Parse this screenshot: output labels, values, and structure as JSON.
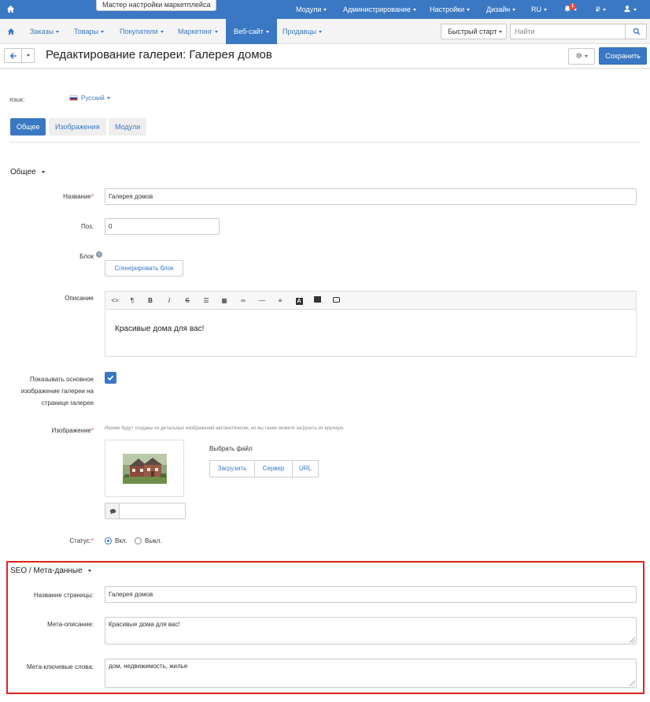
{
  "topbar": {
    "marketplace_btn": "Мастер настройки маркетплейса",
    "menus": [
      "Модули",
      "Администрирование",
      "Настройки",
      "Дизайн",
      "RU"
    ],
    "notif_count": "1",
    "currency": "₽"
  },
  "nav": {
    "items": [
      "Заказы",
      "Товары",
      "Покупатели",
      "Маркетинг",
      "Веб-сайт",
      "Продавцы"
    ],
    "quick_start": "Быстрый старт",
    "search_placeholder": "Найти"
  },
  "title": {
    "text": "Редактирование галереи: Галерея домов",
    "save_label": "Сохранить"
  },
  "language": {
    "label": "язык:",
    "value": "Русский"
  },
  "tabs": [
    "Общее",
    "Изображения",
    "Модули"
  ],
  "general": {
    "section_title": "Общее",
    "name_label": "Название",
    "name_value": "Галерея домов",
    "pos_label": "Поз.",
    "pos_value": "0",
    "block_label": "Блок",
    "generate_block": "Сгенерировать блок",
    "desc_label": "Описание",
    "desc_text": "Красивые дома для вас!",
    "show_main_label": [
      "Показывать основное",
      "изображение галереи на",
      "странице галереи"
    ],
    "image_label": "Изображение",
    "image_hint": "Иконки будут созданы из детальных изображений автоматически, но вы также можете загрузить их вручную.",
    "choose_file": "Выбрать файл",
    "upload_buttons": [
      "Загрузить",
      "Сервер",
      "URL"
    ],
    "status_label": "Статус:",
    "status_on": "Вкл.",
    "status_off": "Выкл."
  },
  "seo": {
    "section_title": "SEO / Мета-данные",
    "page_title_label": "Название страницы:",
    "page_title_value": "Галерея домов",
    "meta_desc_label": "Мета-описание:",
    "meta_desc_value": "Красивые дома для вас!",
    "meta_keywords_label": "Мета-ключевые слова:",
    "meta_keywords_value": "дом, недвижимость, жилье"
  },
  "colors": {
    "primary": "#3a78c3",
    "highlight": "#e02020"
  }
}
